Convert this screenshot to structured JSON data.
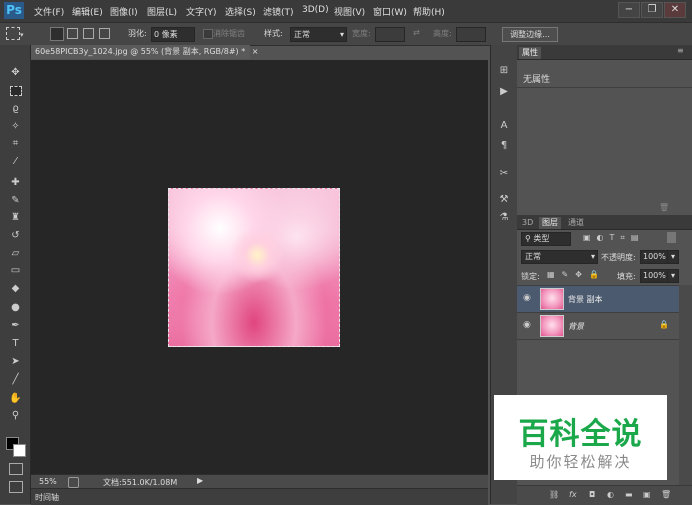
{
  "app": {
    "logo": "Ps"
  },
  "menu": [
    "文件(F)",
    "编辑(E)",
    "图像(I)",
    "图层(L)",
    "文字(Y)",
    "选择(S)",
    "滤镜(T)",
    "3D(D)",
    "视图(V)",
    "窗口(W)",
    "帮助(H)"
  ],
  "window_controls": {
    "minimize": "−",
    "restore": "❐",
    "close": "✕"
  },
  "options": {
    "feather_label": "羽化:",
    "feather_value": "0 像素",
    "antialias_label": "消除锯齿",
    "style_label": "样式:",
    "style_value": "正常",
    "width_label": "宽度:",
    "height_label": "高度:",
    "refine_button": "调整边缘..."
  },
  "document": {
    "tab_title": "60e58PICB3y_1024.jpg @ 55% (背景 副本, RGB/8#) *",
    "tab_close": "×",
    "zoom": "55%",
    "doc_info": "文档:551.0K/1.08M"
  },
  "timeline": {
    "label": "时间轴"
  },
  "properties": {
    "tab": "属性",
    "empty_text": "无属性"
  },
  "layers_panel": {
    "tabs": [
      "3D",
      "图层",
      "通道"
    ],
    "filter_kind": "类型",
    "blend_mode": "正常",
    "opacity_label": "不透明度:",
    "opacity_value": "100%",
    "lock_label": "锁定:",
    "fill_label": "填充:",
    "fill_value": "100%",
    "layers": [
      {
        "name": "背景 副本",
        "selected": true
      },
      {
        "name": "背景",
        "selected": false
      }
    ],
    "footer_icons": [
      "link-icon",
      "fx-icon",
      "mask-icon",
      "adjustment-icon",
      "group-icon",
      "new-layer-icon",
      "trash-icon"
    ]
  },
  "watermark": {
    "line1": "百科全说",
    "line2": "助你轻松解决"
  },
  "colors": {
    "accent_selected_layer": "#4b5a6e",
    "watermark_green": "#1aa84a"
  }
}
